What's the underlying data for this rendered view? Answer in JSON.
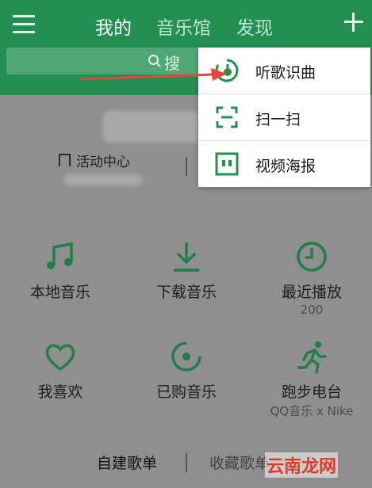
{
  "header": {
    "tabs": [
      {
        "label": "我的",
        "active": true
      },
      {
        "label": "音乐馆",
        "active": false
      },
      {
        "label": "发现",
        "active": false
      }
    ]
  },
  "search": {
    "label": "搜"
  },
  "activity": {
    "label": "活动中心"
  },
  "grid": [
    {
      "label": "本地音乐",
      "sub": "",
      "icon": "music-note-icon"
    },
    {
      "label": "下载音乐",
      "sub": "",
      "icon": "download-icon"
    },
    {
      "label": "最近播放",
      "sub": "200",
      "icon": "clock-icon"
    },
    {
      "label": "我喜欢",
      "sub": "",
      "icon": "heart-icon"
    },
    {
      "label": "已购音乐",
      "sub": "",
      "icon": "disc-icon"
    },
    {
      "label": "跑步电台",
      "sub": "QQ音乐 x Nike",
      "icon": "runner-icon"
    }
  ],
  "bottom_tabs": [
    {
      "label": "自建歌单"
    },
    {
      "label": "收藏歌单"
    }
  ],
  "popup": {
    "items": [
      {
        "label": "听歌识曲",
        "icon": "song-recognition-icon"
      },
      {
        "label": "扫一扫",
        "icon": "scan-icon"
      },
      {
        "label": "视频海报",
        "icon": "video-poster-icon"
      }
    ]
  },
  "watermark": "云南龙网",
  "colors": {
    "brand_green": "#238f52",
    "overlay_gray": "#8f8f8f",
    "arrow_red": "#e8453c"
  }
}
